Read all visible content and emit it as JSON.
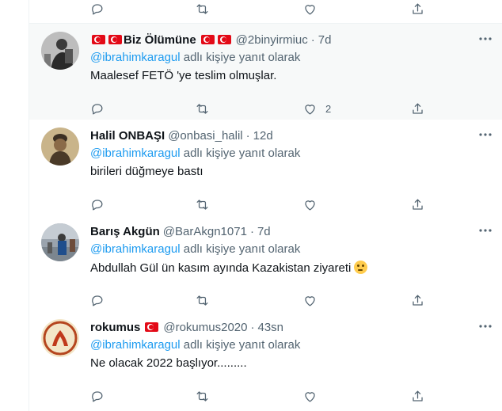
{
  "top_actions": {
    "like_count": ""
  },
  "tweets": [
    {
      "name": "Biz Ölümüne",
      "handle": "@2binyirmiuc",
      "time": "7d",
      "replying_prefix": "",
      "mention": "@ibrahimkaragul",
      "replying_suffix": "adlı kişiye yanıt olarak",
      "text": "Maalesef FETÖ 'ye teslim olmuşlar.",
      "likes": "2",
      "avatar_icon": "person-photo-icon"
    },
    {
      "name": "Halil ONBAŞI",
      "handle": "@onbasi_halil",
      "time": "12d",
      "mention": "@ibrahimkaragul",
      "replying_suffix": "adlı kişiye yanıt olarak",
      "text": "birileri düğmeye bastı",
      "likes": "",
      "avatar_icon": "portrait-icon"
    },
    {
      "name": "Barış Akgün",
      "handle": "@BarAkgn1071",
      "time": "7d",
      "mention": "@ibrahimkaragul",
      "replying_suffix": "adlı kişiye yanıt olarak",
      "text": "Abdullah Gül ün kasım ayında Kazakistan ziyareti",
      "likes": "",
      "avatar_icon": "street-photo-icon"
    },
    {
      "name": "rokumus",
      "handle": "@rokumus2020",
      "time": "43sn",
      "mention": "@ibrahimkaragul",
      "replying_suffix": "adlı kişiye yanıt olarak",
      "text": "Ne olacak 2022 başlıyor.........",
      "likes": "",
      "avatar_icon": "emblem-icon"
    }
  ],
  "icons": [
    "reply-icon",
    "retweet-icon",
    "like-icon",
    "share-icon",
    "more-icon",
    "thinking-emoji-icon",
    "turkish-flag-icon"
  ],
  "colors": {
    "mention": "#1d9bf0",
    "muted": "#536471",
    "text": "#0f1419",
    "highlight_bg": "#f7f9f9",
    "flag_red": "#e30a17"
  }
}
